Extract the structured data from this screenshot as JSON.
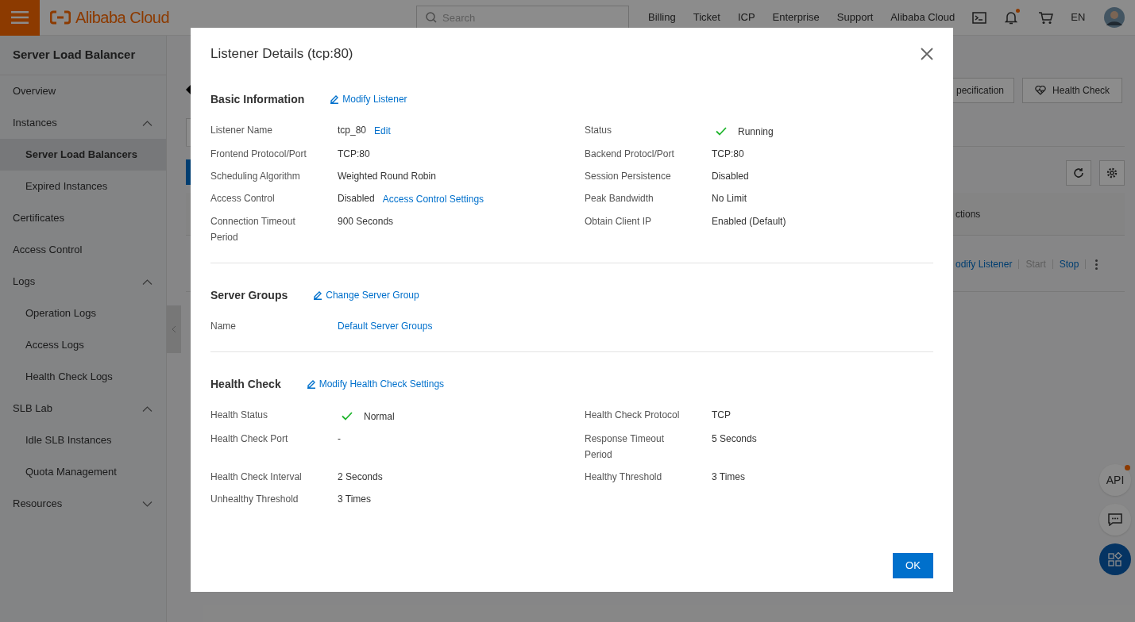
{
  "top_bar": {
    "logo": "Alibaba Cloud",
    "search": {
      "placeholder": "Search"
    },
    "nav": [
      "Billing",
      "Ticket",
      "ICP",
      "Enterprise",
      "Support",
      "Alibaba Cloud"
    ],
    "language": "EN"
  },
  "sidebar": {
    "title": "Server Load Balancer",
    "items": [
      {
        "label": "Overview",
        "selected": false
      },
      {
        "label": "Instances",
        "selected": false,
        "expanded": true,
        "children": [
          {
            "label": "Server Load Balancers",
            "selected": true
          },
          {
            "label": "Expired Instances",
            "selected": false
          }
        ]
      },
      {
        "label": "Certificates",
        "selected": false
      },
      {
        "label": "Access Control",
        "selected": false
      },
      {
        "label": "Logs",
        "selected": false,
        "expanded": true,
        "children": [
          {
            "label": "Operation Logs",
            "selected": false
          },
          {
            "label": "Access Logs",
            "selected": false
          },
          {
            "label": "Health Check Logs",
            "selected": false
          }
        ]
      },
      {
        "label": "SLB Lab",
        "selected": false,
        "expanded": true,
        "children": [
          {
            "label": "Idle SLB Instances",
            "selected": false
          },
          {
            "label": "Quota Management",
            "selected": false
          }
        ]
      },
      {
        "label": "Resources",
        "selected": false,
        "expanded": false
      }
    ]
  },
  "background": {
    "buttons": [
      "pecification",
      "Health Check"
    ],
    "table_header": "ctions",
    "row_actions": [
      {
        "label": "odify Listener",
        "disabled": false
      },
      {
        "label": "Start",
        "disabled": true
      },
      {
        "label": "Stop",
        "disabled": false
      }
    ]
  },
  "floating": {
    "api": "API"
  },
  "modal": {
    "title": "Listener Details (tcp:80)",
    "sections": [
      {
        "title": "Basic Information",
        "action": "Modify Listener",
        "fields": [
          {
            "label": "Listener Name",
            "value": "tcp_80",
            "kind": "text",
            "action": "Edit"
          },
          {
            "label": "Status",
            "value": "Running",
            "kind": "status"
          },
          {
            "label": "Frontend Protocol/Port",
            "value": "TCP:80",
            "kind": "text"
          },
          {
            "label": "Backend Protocl/Port",
            "value": "TCP:80",
            "kind": "text"
          },
          {
            "label": "Scheduling Algorithm",
            "value": "Weighted Round Robin",
            "kind": "text"
          },
          {
            "label": "Session Persistence",
            "value": "Disabled",
            "kind": "text"
          },
          {
            "label": "Access Control",
            "value": "Disabled",
            "kind": "text",
            "action": "Access Control Settings"
          },
          {
            "label": "Peak Bandwidth",
            "value": "No Limit",
            "kind": "text"
          },
          {
            "label": "Connection Timeout Period",
            "value": "900 Seconds",
            "kind": "text"
          },
          {
            "label": "Obtain Client IP",
            "value": "Enabled (Default)",
            "kind": "text"
          }
        ]
      },
      {
        "title": "Server Groups",
        "action": "Change Server Group",
        "fields": [
          {
            "label": "Name",
            "value": "Default Server Groups",
            "kind": "link"
          }
        ]
      },
      {
        "title": "Health Check",
        "action": "Modify Health Check Settings",
        "fields": [
          {
            "label": "Health Status",
            "value": "Normal",
            "kind": "status"
          },
          {
            "label": "Health Check Protocol",
            "value": "TCP",
            "kind": "text"
          },
          {
            "label": "Health Check Port",
            "value": "-",
            "kind": "text"
          },
          {
            "label": "Response Timeout Period",
            "value": "5 Seconds",
            "kind": "text"
          },
          {
            "label": "Health Check Interval",
            "value": "2 Seconds",
            "kind": "text"
          },
          {
            "label": "Healthy Threshold",
            "value": "3 Times",
            "kind": "text"
          },
          {
            "label": "Unhealthy Threshold",
            "value": "3 Times",
            "kind": "text"
          }
        ]
      }
    ],
    "ok_button": "OK"
  }
}
